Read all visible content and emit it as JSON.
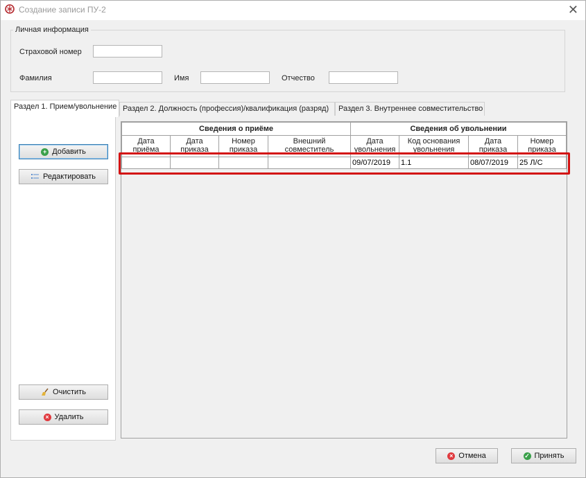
{
  "window": {
    "title": "Создание записи ПУ-2",
    "close_glyph": "✕"
  },
  "personal": {
    "legend": "Личная информация",
    "insurance_label": "Страховой номер",
    "surname_label": "Фамилия",
    "name_label": "Имя",
    "patronymic_label": "Отчество",
    "insurance_value": "",
    "surname_value": "",
    "name_value": "",
    "patronymic_value": ""
  },
  "tabs": [
    {
      "label": "Раздел 1. Прием/увольнение",
      "active": true
    },
    {
      "label": "Раздел 2. Должность (профессия)/квалификация (разряд)",
      "active": false
    },
    {
      "label": "Раздел 3. Внутреннее совместительство",
      "active": false
    }
  ],
  "side_buttons": {
    "add": "Добавить",
    "edit": "Редактировать",
    "clear": "Очистить",
    "delete": "Удалить"
  },
  "grid": {
    "group_hire": "Сведения о приёме",
    "group_dismissal": "Сведения об увольнении",
    "columns": [
      "Дата приёма",
      "Дата приказа",
      "Номер приказа",
      "Внешний совместитель",
      "Дата увольнения",
      "Код основания увольнения",
      "Дата приказа",
      "Номер приказа"
    ],
    "rows": [
      [
        "",
        "",
        "",
        "",
        "09/07/2019",
        "1.1",
        "08/07/2019",
        "25 Л/С"
      ]
    ]
  },
  "footer": {
    "cancel": "Отмена",
    "accept": "Принять"
  },
  "icons": {
    "add": "plus-circle-icon",
    "edit": "list-edit-icon",
    "clear": "broom-icon",
    "delete": "x-circle-icon",
    "cancel": "x-circle-icon",
    "accept": "check-circle-icon"
  },
  "colors": {
    "add_green": "#3aa04a",
    "delete_red": "#e0393e",
    "highlight_red": "#d31212",
    "focus_blue": "#3c7fb1"
  }
}
